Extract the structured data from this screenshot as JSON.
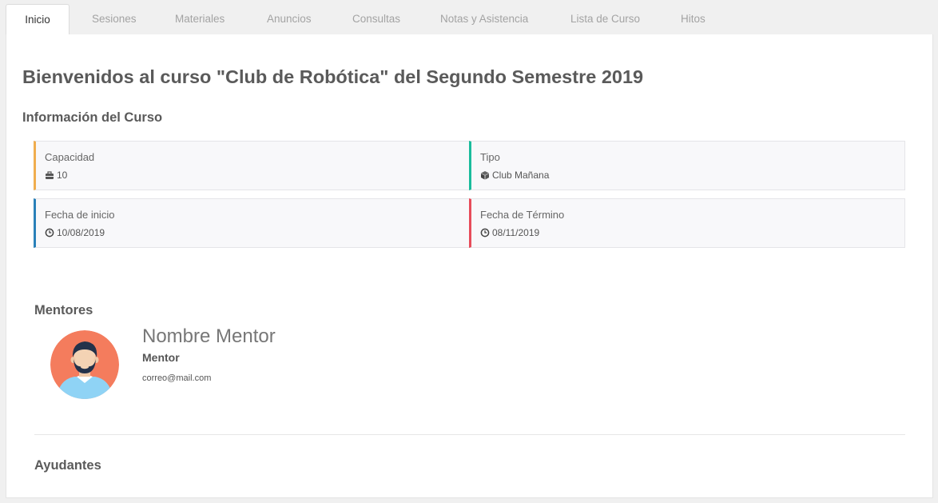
{
  "tabs": [
    {
      "label": "Inicio"
    },
    {
      "label": "Sesiones"
    },
    {
      "label": "Materiales"
    },
    {
      "label": "Anuncios"
    },
    {
      "label": "Consultas"
    },
    {
      "label": "Notas y Asistencia"
    },
    {
      "label": "Lista de Curso"
    },
    {
      "label": "Hitos"
    }
  ],
  "active_tab": "Inicio",
  "page_title": "Bienvenidos al curso \"Club de Robótica\" del Segundo Semestre 2019",
  "info": {
    "heading": "Información del Curso",
    "cards": [
      {
        "label": "Capacidad",
        "value": "10",
        "icon": "briefcase-icon",
        "accent": "#f0ad4e"
      },
      {
        "label": "Tipo",
        "value": "Club Mañana",
        "icon": "cube-icon",
        "accent": "#1abc9c"
      },
      {
        "label": "Fecha de inicio",
        "value": "10/08/2019",
        "icon": "clock-icon",
        "accent": "#2980b9"
      },
      {
        "label": "Fecha de Término",
        "value": "08/11/2019",
        "icon": "clock-icon",
        "accent": "#e74c5a"
      }
    ]
  },
  "mentors": {
    "heading": "Mentores",
    "items": [
      {
        "name": "Nombre Mentor",
        "role": "Mentor",
        "email": "correo@mail.com",
        "avatar_bg": "#f47c5d"
      }
    ]
  },
  "helpers": {
    "heading": "Ayudantes"
  }
}
